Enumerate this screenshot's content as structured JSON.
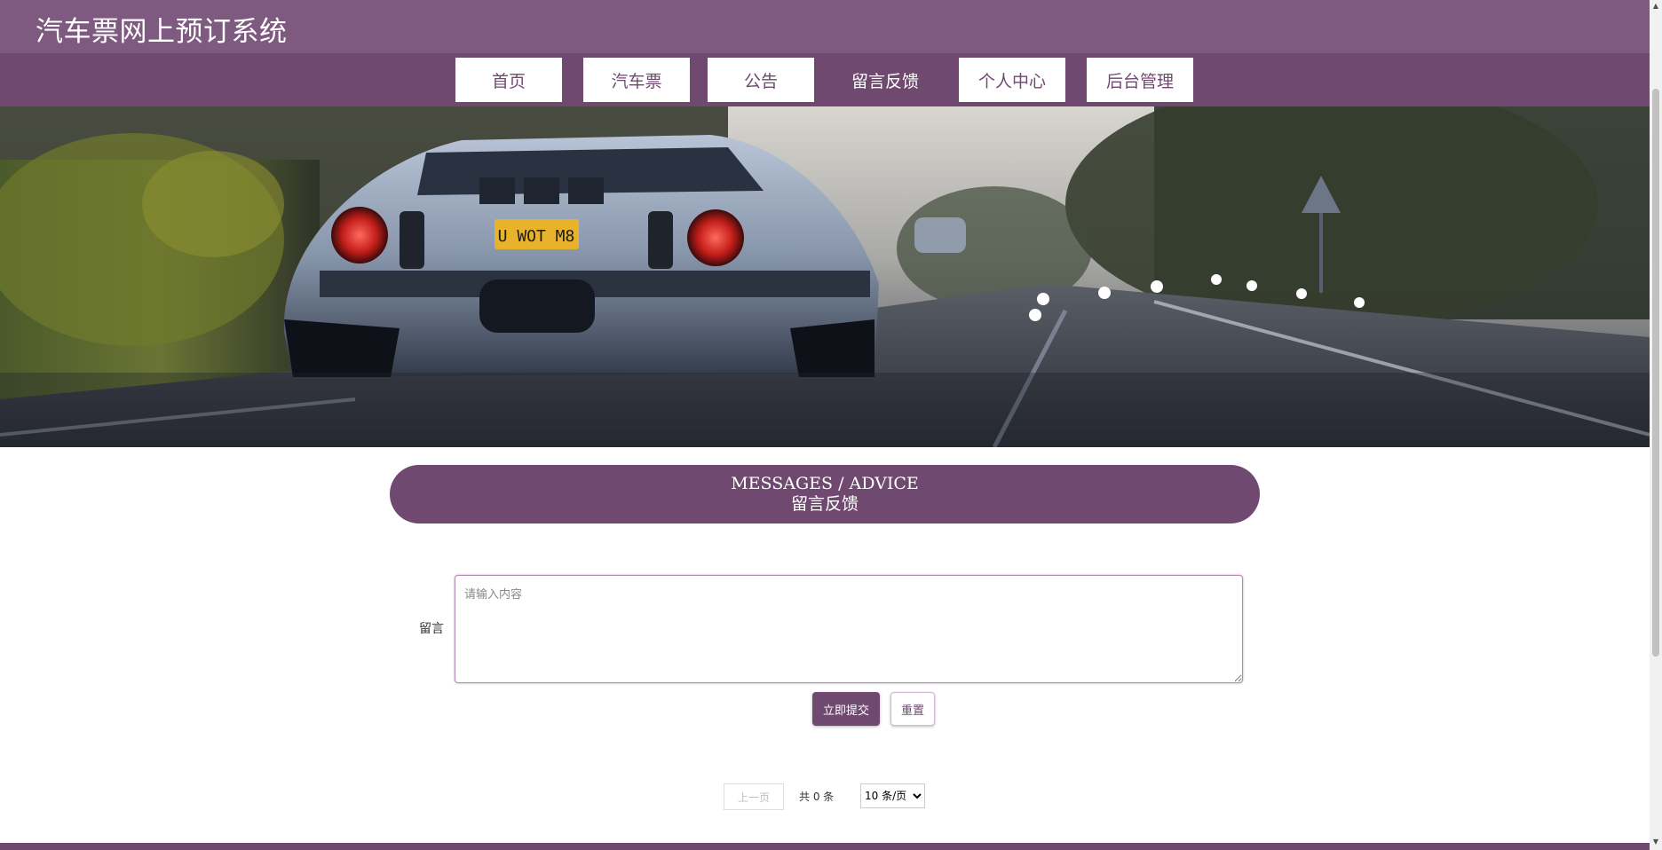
{
  "header": {
    "title": "汽车票网上预订系统"
  },
  "nav": {
    "items": [
      {
        "label": "首页"
      },
      {
        "label": "汽车票"
      },
      {
        "label": "公告"
      },
      {
        "label": "留言反馈",
        "active": true
      },
      {
        "label": "个人中心"
      },
      {
        "label": "后台管理"
      }
    ]
  },
  "hero": {
    "plate_text": "U WOT M8"
  },
  "section": {
    "title_en": "MESSAGES / ADVICE",
    "title_cn": "留言反馈"
  },
  "form": {
    "label": "留言",
    "placeholder": "请输入内容",
    "value": "",
    "submit_label": "立即提交",
    "reset_label": "重置"
  },
  "pagination": {
    "prev_label": "上一页",
    "total_text": "共 0 条",
    "page_size_options": [
      "10 条/页"
    ],
    "page_size_selected": "10 条/页"
  },
  "colors": {
    "primary": "#6f4970",
    "header": "#7e5a80",
    "white": "#ffffff"
  }
}
